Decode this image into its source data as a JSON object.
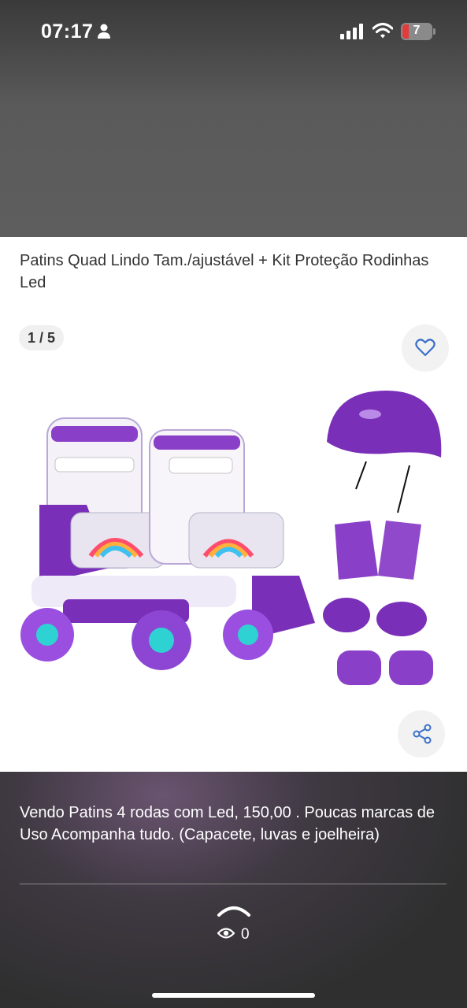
{
  "status_bar": {
    "time": "07:17",
    "battery_level": "7",
    "icons": [
      "person-icon",
      "signal-icon",
      "wifi-icon",
      "battery-icon"
    ]
  },
  "listing": {
    "title": "Patins Quad Lindo Tam./ajustável + Kit Proteção Rodinhas Led",
    "image_counter": "1 / 5",
    "description": "Vendo Patins 4 rodas com Led, 150,00 . Poucas marcas de Uso Acompanha tudo. (Capacete, luvas e joelheira)",
    "views": "0"
  },
  "colors": {
    "accent": "#3a6fc9",
    "purple": "#7a2fb8",
    "battery_low": "#e23b3b"
  }
}
